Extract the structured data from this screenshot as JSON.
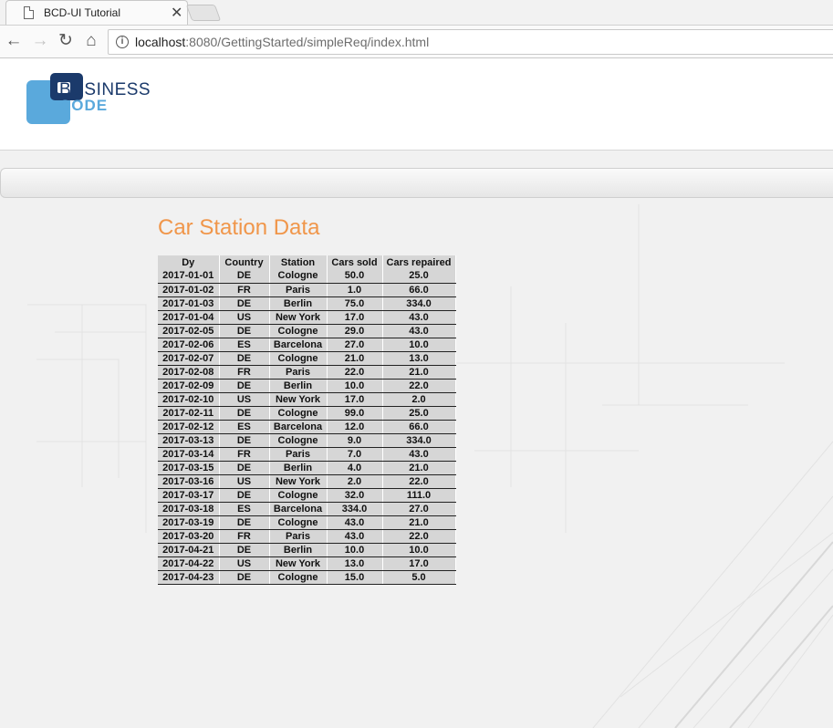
{
  "browser": {
    "tab_title": "BCD-UI Tutorial",
    "tab_close": "✕",
    "url_host": "localhost",
    "url_rest": ":8080/GettingStarted/simpleReq/index.html"
  },
  "logo": {
    "line1": "BUSINESS",
    "line2": "CODE"
  },
  "page": {
    "title": "Car Station Data"
  },
  "table": {
    "headers": [
      "Dy",
      "Country",
      "Station",
      "Cars sold",
      "Cars repaired"
    ],
    "rows": [
      [
        "2017-01-01",
        "DE",
        "Cologne",
        "50.0",
        "25.0"
      ],
      [
        "2017-01-02",
        "FR",
        "Paris",
        "1.0",
        "66.0"
      ],
      [
        "2017-01-03",
        "DE",
        "Berlin",
        "75.0",
        "334.0"
      ],
      [
        "2017-01-04",
        "US",
        "New York",
        "17.0",
        "43.0"
      ],
      [
        "2017-02-05",
        "DE",
        "Cologne",
        "29.0",
        "43.0"
      ],
      [
        "2017-02-06",
        "ES",
        "Barcelona",
        "27.0",
        "10.0"
      ],
      [
        "2017-02-07",
        "DE",
        "Cologne",
        "21.0",
        "13.0"
      ],
      [
        "2017-02-08",
        "FR",
        "Paris",
        "22.0",
        "21.0"
      ],
      [
        "2017-02-09",
        "DE",
        "Berlin",
        "10.0",
        "22.0"
      ],
      [
        "2017-02-10",
        "US",
        "New York",
        "17.0",
        "2.0"
      ],
      [
        "2017-02-11",
        "DE",
        "Cologne",
        "99.0",
        "25.0"
      ],
      [
        "2017-02-12",
        "ES",
        "Barcelona",
        "12.0",
        "66.0"
      ],
      [
        "2017-03-13",
        "DE",
        "Cologne",
        "9.0",
        "334.0"
      ],
      [
        "2017-03-14",
        "FR",
        "Paris",
        "7.0",
        "43.0"
      ],
      [
        "2017-03-15",
        "DE",
        "Berlin",
        "4.0",
        "21.0"
      ],
      [
        "2017-03-16",
        "US",
        "New York",
        "2.0",
        "22.0"
      ],
      [
        "2017-03-17",
        "DE",
        "Cologne",
        "32.0",
        "111.0"
      ],
      [
        "2017-03-18",
        "ES",
        "Barcelona",
        "334.0",
        "27.0"
      ],
      [
        "2017-03-19",
        "DE",
        "Cologne",
        "43.0",
        "21.0"
      ],
      [
        "2017-03-20",
        "FR",
        "Paris",
        "43.0",
        "22.0"
      ],
      [
        "2017-04-21",
        "DE",
        "Berlin",
        "10.0",
        "10.0"
      ],
      [
        "2017-04-22",
        "US",
        "New York",
        "13.0",
        "17.0"
      ],
      [
        "2017-04-23",
        "DE",
        "Cologne",
        "15.0",
        "5.0"
      ]
    ]
  },
  "colors": {
    "title": "#f0964a",
    "logo_dark": "#1b3a6b",
    "logo_light": "#5aa9dc",
    "table_bg": "#d6d6d6"
  }
}
